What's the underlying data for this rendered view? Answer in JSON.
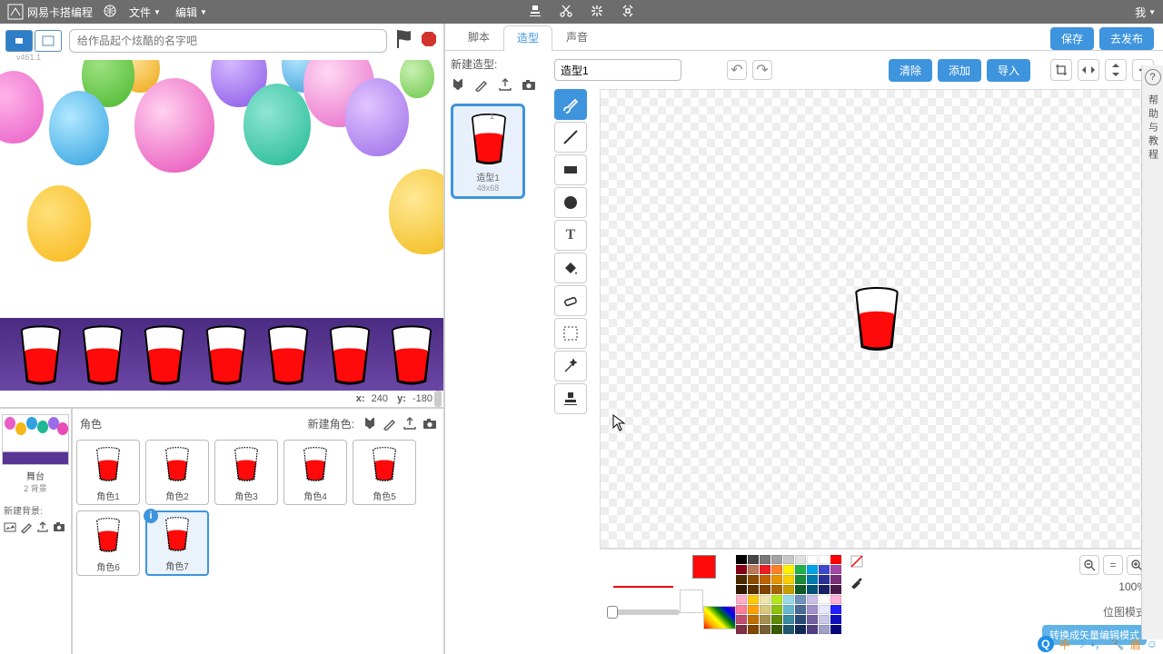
{
  "topbar": {
    "brand": "网易卡搭编程",
    "menu_file": "文件",
    "menu_edit": "编辑",
    "menu_me": "我"
  },
  "project_name_placeholder": "给作品起个炫酷的名字吧",
  "version": "v461.1",
  "tabs": {
    "script": "脚本",
    "costume": "造型",
    "sound": "声音"
  },
  "buttons": {
    "save": "保存",
    "publish": "去发布",
    "clear": "清除",
    "add": "添加",
    "import": "导入",
    "convert_mode": "转换成矢量编辑模式"
  },
  "stage": {
    "x_label": "x:",
    "x": "240",
    "y_label": "y:",
    "y": "-180"
  },
  "sprites_panel": {
    "label": "角色",
    "new_sprite_label": "新建角色:",
    "stage_label": "舞台",
    "stage_bg_count": "2 背景",
    "new_bg_label": "新建背景:",
    "sprites": [
      "角色1",
      "角色2",
      "角色3",
      "角色4",
      "角色5",
      "角色6",
      "角色7"
    ]
  },
  "costume": {
    "new_label": "新建造型:",
    "name": "造型1",
    "dim": "48x68",
    "name_input": "造型1"
  },
  "zoom": {
    "percent": "100%",
    "mode_label": "位图模式"
  },
  "help": {
    "text": "帮助与教程"
  },
  "ime": {
    "mode": "中"
  },
  "colors": {
    "primary_swatch": "#ff0a0a",
    "palette": [
      "#000000",
      "#464646",
      "#787878",
      "#a3a3a3",
      "#c8c8c8",
      "#e0e0e0",
      "#ffffff",
      "#ffffff",
      "#ff0000",
      "#880015",
      "#b97a57",
      "#ed1c24",
      "#ff7f27",
      "#fff200",
      "#22b14c",
      "#00a2e8",
      "#3f48cc",
      "#a349a4",
      "#4b2a00",
      "#8b4d00",
      "#c06400",
      "#e89600",
      "#f9d000",
      "#1a8a36",
      "#007bb0",
      "#2a3299",
      "#7a307a",
      "#2e1a00",
      "#5a3200",
      "#804200",
      "#a86400",
      "#c99e00",
      "#0f5a22",
      "#005577",
      "#1a2066",
      "#4a1a4a",
      "#ffaec9",
      "#ffc90e",
      "#efe4b0",
      "#b5e61d",
      "#99d9ea",
      "#7092be",
      "#c8bfe7",
      "#ffffff",
      "#ffb0d8",
      "#ff8099",
      "#ffa000",
      "#d8c880",
      "#8ec010",
      "#6ab8d0",
      "#4a6a98",
      "#a090c8",
      "#e8e8ff",
      "#2020ff",
      "#c05070",
      "#c07000",
      "#a89050",
      "#5e8a08",
      "#3a8aa0",
      "#2a4a78",
      "#7060a0",
      "#c8c8e8",
      "#1010c0",
      "#803048",
      "#804800",
      "#786034",
      "#3a5a04",
      "#205a70",
      "#102a58",
      "#504080",
      "#a0a0c8",
      "#060680"
    ]
  }
}
